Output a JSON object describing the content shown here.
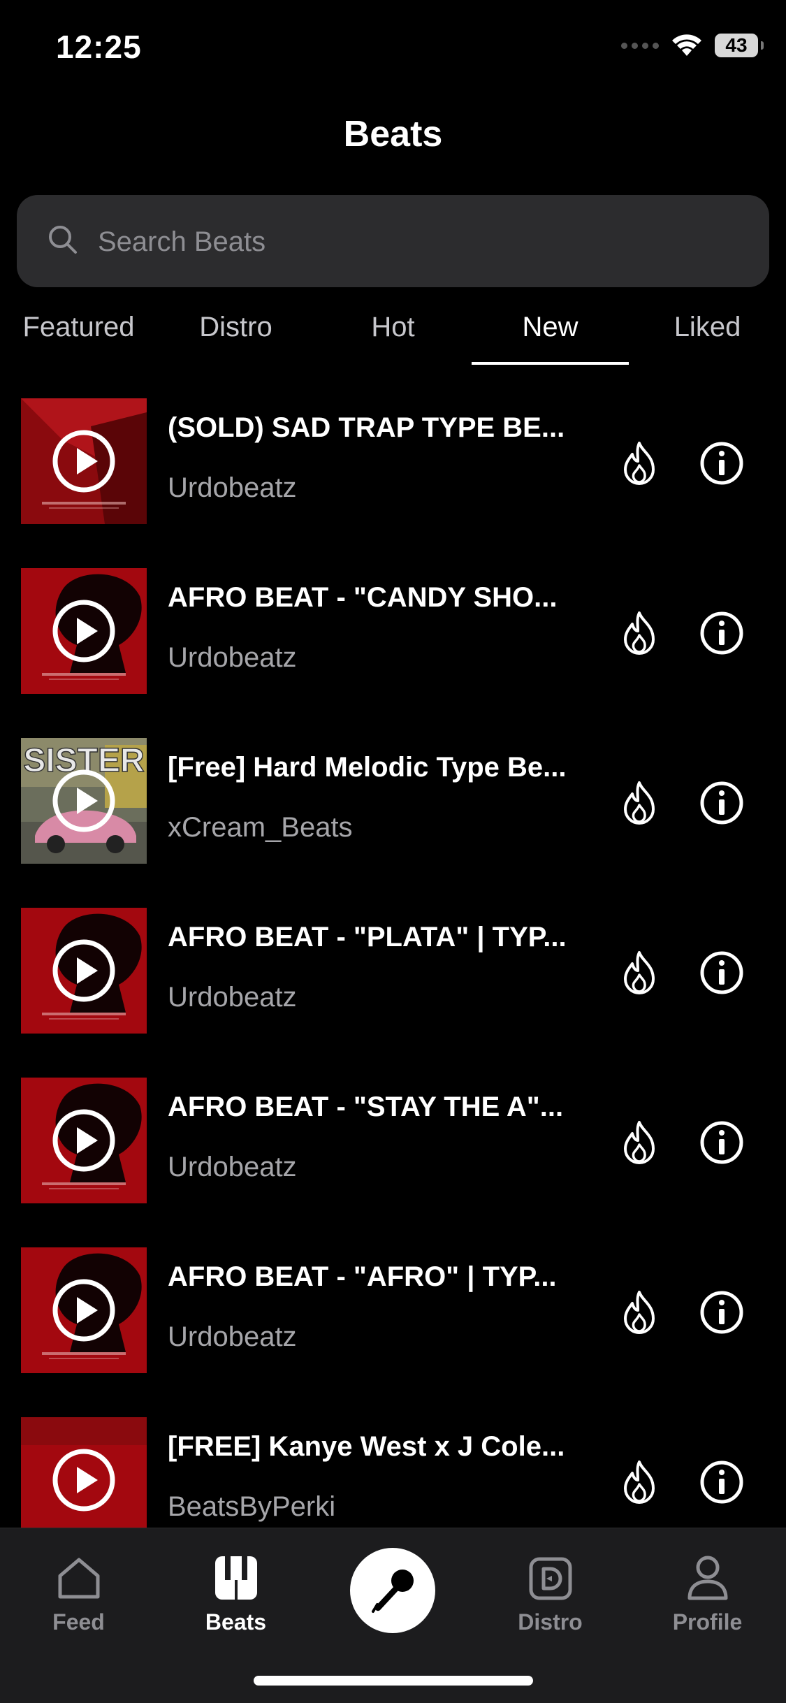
{
  "status": {
    "time": "12:25",
    "battery": "43"
  },
  "header": {
    "title": "Beats"
  },
  "search": {
    "placeholder": "Search Beats",
    "value": ""
  },
  "tabs": [
    {
      "label": "Featured",
      "active": false
    },
    {
      "label": "Distro",
      "active": false
    },
    {
      "label": "Hot",
      "active": false
    },
    {
      "label": "New",
      "active": true
    },
    {
      "label": "Liked",
      "active": false
    }
  ],
  "beats": [
    {
      "title": "(SOLD) SAD TRAP TYPE BE...",
      "artist": "Urdobeatz",
      "cover": "red-dark"
    },
    {
      "title": "AFRO BEAT - \"CANDY SHO...",
      "artist": "Urdobeatz",
      "cover": "red-silhouette"
    },
    {
      "title": "[Free] Hard Melodic Type Be...",
      "artist": "xCream_Beats",
      "cover": "sister-car"
    },
    {
      "title": "AFRO BEAT - \"PLATA\" | TYP...",
      "artist": "Urdobeatz",
      "cover": "red-silhouette"
    },
    {
      "title": "AFRO BEAT - \"STAY THE A\"...",
      "artist": "Urdobeatz",
      "cover": "red-silhouette"
    },
    {
      "title": "AFRO BEAT - \"AFRO\" | TYP...",
      "artist": "Urdobeatz",
      "cover": "red-silhouette"
    },
    {
      "title": "[FREE] Kanye West x J Cole...",
      "artist": "BeatsByPerki",
      "cover": "red-plain"
    }
  ],
  "sister_text": "SISTER",
  "tab_bar": {
    "feed": "Feed",
    "beats": "Beats",
    "distro": "Distro",
    "profile": "Profile"
  },
  "colors": {
    "background": "#000000",
    "accent_red": "#a3080f",
    "secondary_text": "#a6a6aa"
  }
}
